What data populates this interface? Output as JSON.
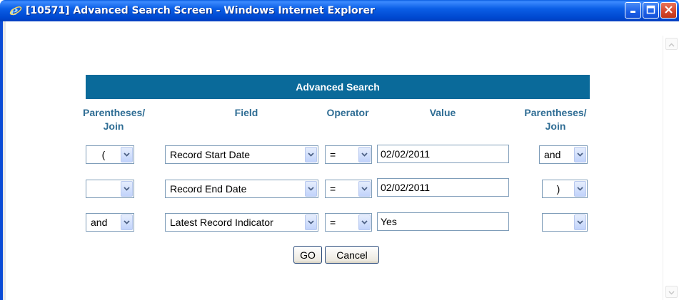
{
  "window": {
    "title": "[10571] Advanced Search Screen - Windows Internet Explorer"
  },
  "panel": {
    "title": "Advanced Search"
  },
  "headers": {
    "paren_left": "Parentheses/ Join",
    "field": "Field",
    "operator": "Operator",
    "value": "Value",
    "paren_right": "Parentheses/ Join"
  },
  "rows": [
    {
      "left": "(",
      "field": "Record Start Date",
      "operator": "=",
      "value": "02/02/2011",
      "right": "and"
    },
    {
      "left": "",
      "field": "Record End Date",
      "operator": "=",
      "value": "02/02/2011",
      "right": ")"
    },
    {
      "left": "and",
      "field": "Latest Record Indicator",
      "operator": "=",
      "value": "Yes",
      "right": ""
    }
  ],
  "buttons": {
    "go": "GO",
    "cancel": "Cancel"
  },
  "colors": {
    "panel_bg": "#0a6a9a",
    "header_text": "#2f6d94",
    "titlebar": "#0b5fe6"
  },
  "icons": [
    "ie-icon",
    "minimize-icon",
    "maximize-icon",
    "close-icon",
    "chevron-down-icon",
    "scroll-up-icon",
    "scroll-down-icon"
  ]
}
